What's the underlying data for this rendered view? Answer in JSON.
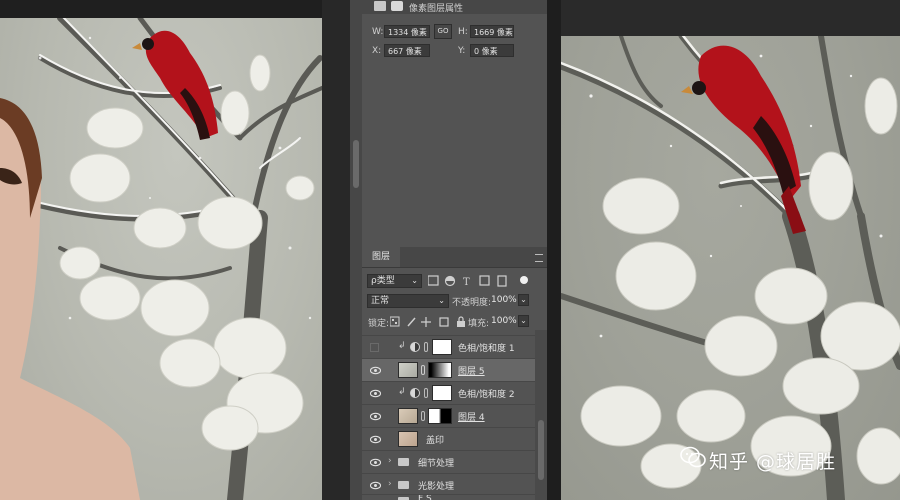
{
  "properties_panel": {
    "title": "像素图层属性",
    "width_label": "W:",
    "width_value": "1334 像素",
    "height_label": "H:",
    "height_value": "1669 像素",
    "link_label": "GO",
    "x_label": "X:",
    "x_value": "667 像素",
    "y_label": "Y:",
    "y_value": "0 像素"
  },
  "layers_panel": {
    "tab_label": "图层",
    "filter_kind": "ρ类型",
    "blend_mode": "正常",
    "opacity_label": "不透明度:",
    "opacity_value": "100%",
    "lock_label": "锁定:",
    "fill_label": "填充:",
    "fill_value": "100%",
    "layers": [
      {
        "name": "色相/饱和度 1"
      },
      {
        "name": "图层 5"
      },
      {
        "name": "色相/饱和度 2"
      },
      {
        "name": "图层 4"
      },
      {
        "name": "盖印"
      },
      {
        "name": "细节处理"
      },
      {
        "name": "光影处理"
      },
      {
        "name": "F S"
      }
    ]
  },
  "watermark": {
    "text": "知乎 @球居胜"
  },
  "colors": {
    "panel_bg": "#535353",
    "selected_row": "#676767",
    "cardinal_red": "#b3121b"
  }
}
